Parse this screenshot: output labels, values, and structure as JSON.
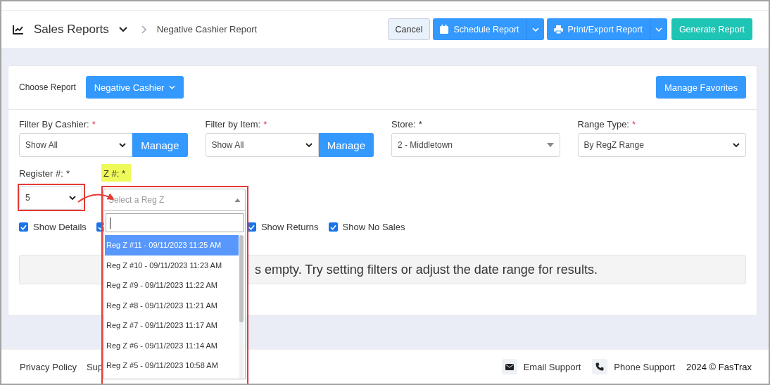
{
  "header": {
    "title": "Sales Reports",
    "breadcrumb": "Negative Cashier Report",
    "buttons": [
      {
        "kind": "secondary",
        "label": "Cancel"
      },
      {
        "kind": "split",
        "label": "Schedule Report"
      },
      {
        "kind": "split",
        "label": "Print/Export Report"
      },
      {
        "kind": "success",
        "label": "Generate Report"
      }
    ]
  },
  "report": {
    "label": "Choose Report",
    "value": "Negative Cashier",
    "favorites": "Manage Favorites"
  },
  "filters": [
    {
      "kind": "select-manage",
      "label": "Filter By Cashier:",
      "mark": "*",
      "mark_red": true,
      "value": "Show All",
      "button": "Manage"
    },
    {
      "kind": "select-manage",
      "label": "Filter by Item:",
      "mark": "*",
      "mark_red": true,
      "value": "Show All",
      "button": "Manage"
    },
    {
      "kind": "select2",
      "label": "Store:",
      "mark": "*",
      "mark_red": false,
      "value": "2 - Middletown"
    },
    {
      "kind": "select",
      "label": "Range Type:",
      "mark": "*",
      "mark_red": true,
      "value": "By RegZ Range"
    }
  ],
  "register": {
    "label": "Register #:",
    "mark": "*",
    "value": "5",
    "annotated": true
  },
  "z": {
    "label": "Z #:",
    "mark": "*",
    "highlighted": true,
    "placeholder": "Select a Reg Z",
    "annotated": true,
    "open": true,
    "options": [
      {
        "label": "Reg Z #11 - 09/11/2023 11:25 AM",
        "selected": true
      },
      {
        "label": "Reg Z #10 - 09/11/2023 11:23 AM",
        "selected": false
      },
      {
        "label": "Reg Z #9 - 09/11/2023 11:22 AM",
        "selected": false
      },
      {
        "label": "Reg Z #8 - 09/11/2023 11:21 AM",
        "selected": false
      },
      {
        "label": "Reg Z #7 - 09/11/2023 11:17 AM",
        "selected": false
      },
      {
        "label": "Reg Z #6 - 09/11/2023 11:14 AM",
        "selected": false
      },
      {
        "label": "Reg Z #5 - 09/11/2023 10:58 AM",
        "selected": false
      }
    ]
  },
  "checkboxes": [
    {
      "label": "Show Details",
      "checked": true
    },
    {
      "checked": true
    },
    {
      "label": "Show Returns",
      "checked": true
    },
    {
      "label": "Show No Sales",
      "checked": true
    }
  ],
  "empty_message": "s empty. Try setting filters or adjust the date range for results.",
  "footer": {
    "links": [
      "Privacy Policy",
      "Sup"
    ],
    "support": [
      {
        "label": "Email Support"
      },
      {
        "label": "Phone Support"
      }
    ],
    "copyright": "2024 © FasTrax"
  }
}
